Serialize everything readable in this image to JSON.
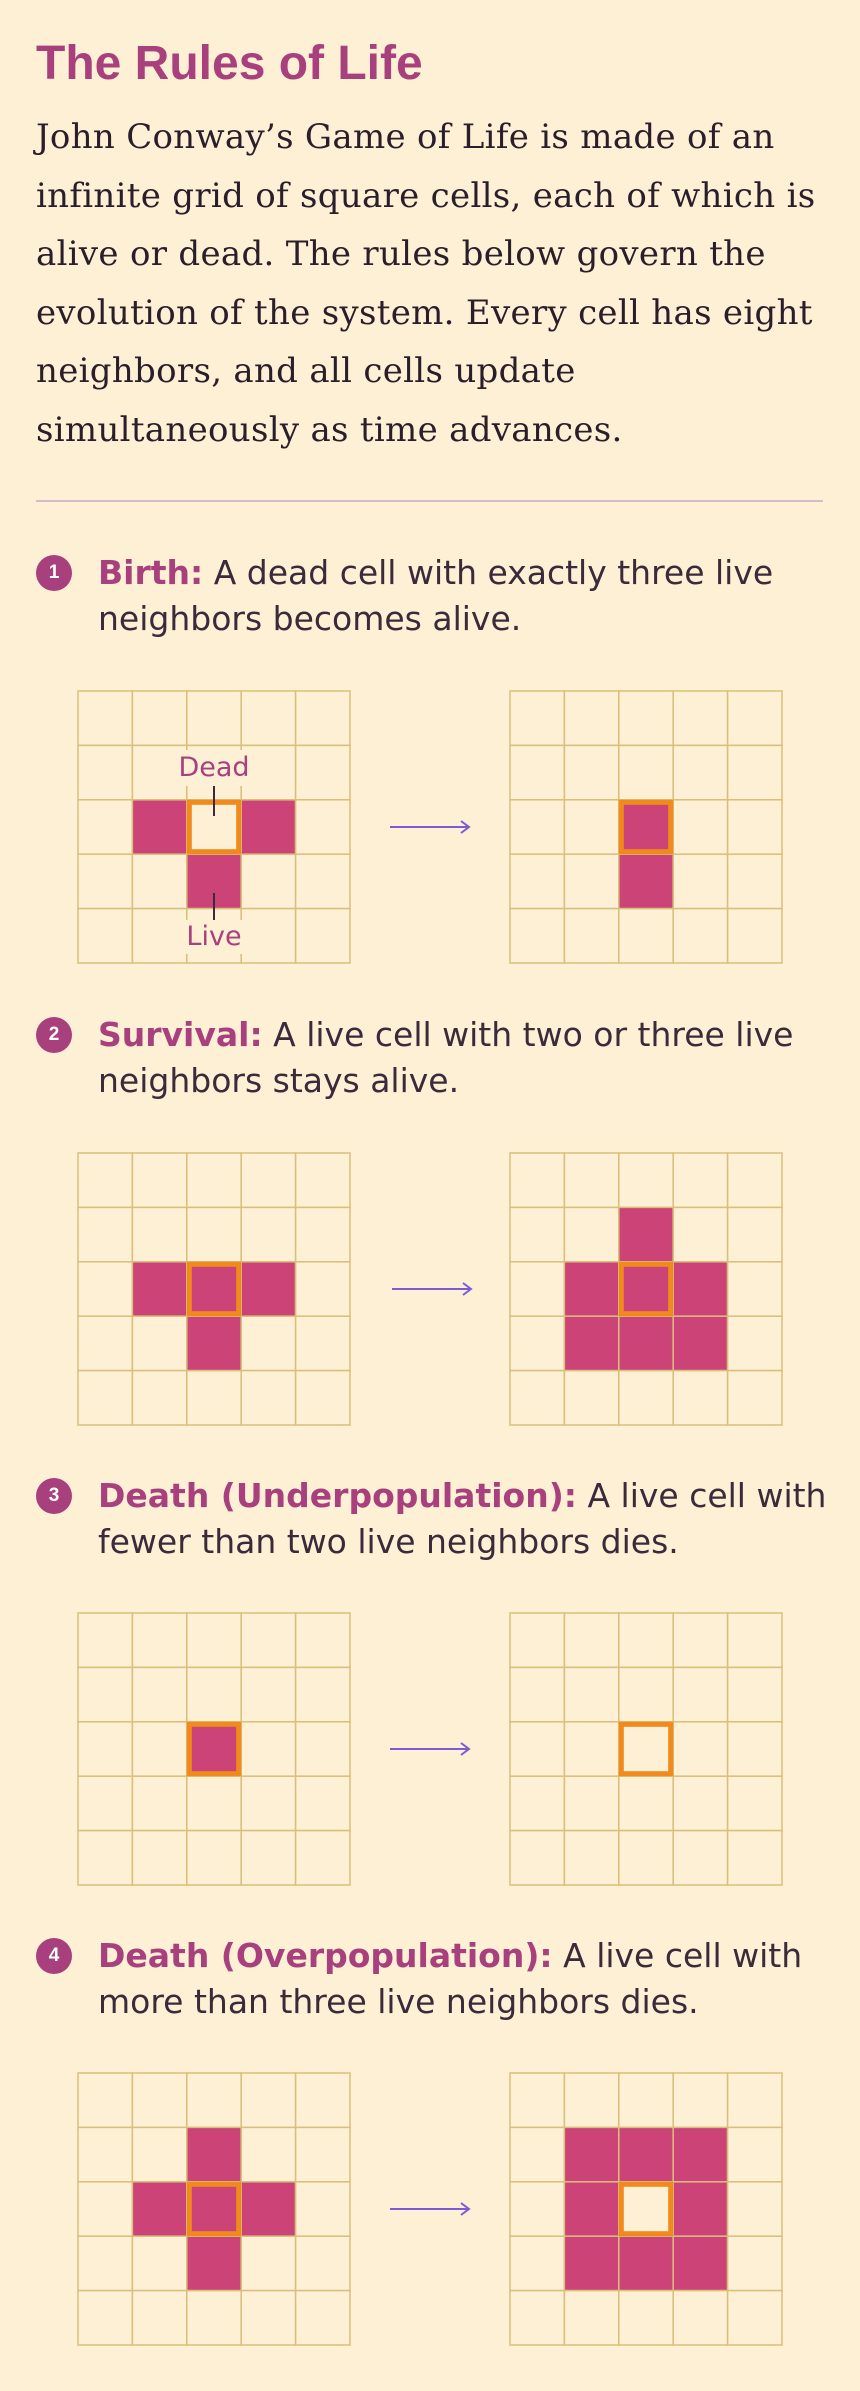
{
  "title": "The Rules of Life",
  "intro": "John Conway’s Game of Life is made of an infinite grid of square cells, each of which is alive or dead. The rules below govern the evolution of the system. Every cell has eight neighbors, and all cells update simultaneously as time advances.",
  "colors": {
    "background": "#fdf0d5",
    "accent": "#a8407e",
    "live_cell": "#cc4477",
    "grid_line": "#d9bf7a",
    "highlight": "#f08a1c",
    "arrow": "#7c5cd6"
  },
  "rules": [
    {
      "number": "1",
      "name": "Birth:",
      "text": "A dead cell with exactly three live neighbors becomes alive.",
      "before": {
        "live": [
          [
            2,
            1
          ],
          [
            2,
            3
          ],
          [
            3,
            2
          ]
        ],
        "focus": [
          2,
          2
        ],
        "focus_live": false
      },
      "after": {
        "live": [
          [
            2,
            2
          ],
          [
            3,
            2
          ]
        ],
        "focus": [
          2,
          2
        ],
        "focus_live": true
      },
      "labels": {
        "dead": "Dead",
        "live": "Live"
      }
    },
    {
      "number": "2",
      "name": "Survival:",
      "text": "A live cell with two or three live neighbors stays alive.",
      "before": {
        "live": [
          [
            2,
            1
          ],
          [
            2,
            2
          ],
          [
            2,
            3
          ],
          [
            3,
            2
          ]
        ],
        "focus": [
          2,
          2
        ],
        "focus_live": true
      },
      "after": {
        "live": [
          [
            1,
            2
          ],
          [
            2,
            1
          ],
          [
            2,
            2
          ],
          [
            2,
            3
          ],
          [
            3,
            1
          ],
          [
            3,
            2
          ],
          [
            3,
            3
          ]
        ],
        "focus": [
          2,
          2
        ],
        "focus_live": true
      }
    },
    {
      "number": "3",
      "name": "Death (Underpopulation):",
      "text": "A live cell with fewer than two live neighbors dies.",
      "before": {
        "live": [
          [
            2,
            2
          ]
        ],
        "focus": [
          2,
          2
        ],
        "focus_live": true
      },
      "after": {
        "live": [],
        "focus": [
          2,
          2
        ],
        "focus_live": false
      }
    },
    {
      "number": "4",
      "name": "Death (Overpopulation):",
      "text": "A live cell with more than three live neighbors dies.",
      "before": {
        "live": [
          [
            1,
            2
          ],
          [
            2,
            1
          ],
          [
            2,
            2
          ],
          [
            2,
            3
          ],
          [
            3,
            2
          ]
        ],
        "focus": [
          2,
          2
        ],
        "focus_live": true
      },
      "after": {
        "live": [
          [
            1,
            1
          ],
          [
            1,
            2
          ],
          [
            1,
            3
          ],
          [
            2,
            1
          ],
          [
            2,
            3
          ],
          [
            3,
            1
          ],
          [
            3,
            2
          ],
          [
            3,
            3
          ]
        ],
        "focus": [
          2,
          2
        ],
        "focus_live": false
      }
    }
  ]
}
